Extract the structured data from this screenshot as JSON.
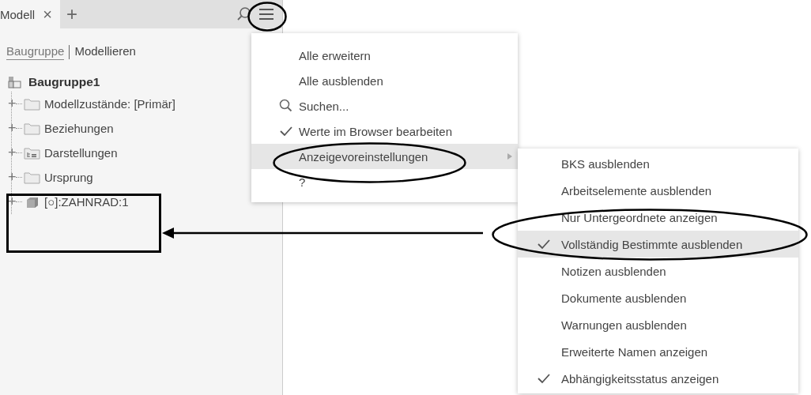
{
  "tabs": [
    {
      "label": "Modell",
      "selected": true,
      "close": "×"
    }
  ],
  "add_tab": "+",
  "view_switch": [
    {
      "label": "Baugruppe",
      "selected": true
    },
    {
      "label": "Modellieren",
      "selected": false
    }
  ],
  "tree": {
    "label": "Baugruppe1",
    "kind": "assembly",
    "children": [
      {
        "label": "Modellzustände: [Primär]",
        "kind": "folder",
        "expander": "+"
      },
      {
        "label": "Beziehungen",
        "kind": "folder",
        "expander": "+"
      },
      {
        "label": "Darstellungen",
        "kind": "views",
        "expander": "+"
      },
      {
        "label": "Ursprung",
        "kind": "folder",
        "expander": "+"
      },
      {
        "label": "[○]:ZAHNRAD:1",
        "kind": "part",
        "expander": "+"
      }
    ]
  },
  "menu": [
    {
      "label": "Alle erweitern",
      "kind": "plain",
      "highlighted": false
    },
    {
      "label": "Alle ausblenden",
      "kind": "plain",
      "highlighted": false
    },
    {
      "label": "Suchen...",
      "kind": "search",
      "highlighted": false
    },
    {
      "label": "Werte im Browser bearbeiten",
      "kind": "check",
      "checked": true,
      "highlighted": false
    },
    {
      "label": "Anzeigevoreinstellungen",
      "kind": "submenu",
      "highlighted": true
    },
    {
      "label": "?",
      "kind": "plain",
      "highlighted": false
    }
  ],
  "submenu": [
    {
      "label": "BKS ausblenden",
      "checked": false,
      "highlighted": false
    },
    {
      "label": "Arbeitselemente ausblenden",
      "checked": false,
      "highlighted": false
    },
    {
      "label": "Nur Untergeordnete anzeigen",
      "checked": false,
      "highlighted": false
    },
    {
      "label": "Vollständig Bestimmte ausblenden",
      "checked": true,
      "highlighted": true
    },
    {
      "label": "Notizen ausblenden",
      "checked": false,
      "highlighted": false
    },
    {
      "label": "Dokumente ausblenden",
      "checked": false,
      "highlighted": false
    },
    {
      "label": "Warnungen ausblenden",
      "checked": false,
      "highlighted": false
    },
    {
      "label": "Erweiterte Namen anzeigen",
      "checked": false,
      "highlighted": false
    },
    {
      "label": "Abhängigkeitsstatus anzeigen",
      "checked": true,
      "highlighted": false
    }
  ],
  "annotations": [
    {
      "kind": "ellipse"
    },
    {
      "kind": "ellipse"
    },
    {
      "kind": "ellipse"
    },
    {
      "kind": "rect"
    },
    {
      "kind": "arrow"
    }
  ]
}
